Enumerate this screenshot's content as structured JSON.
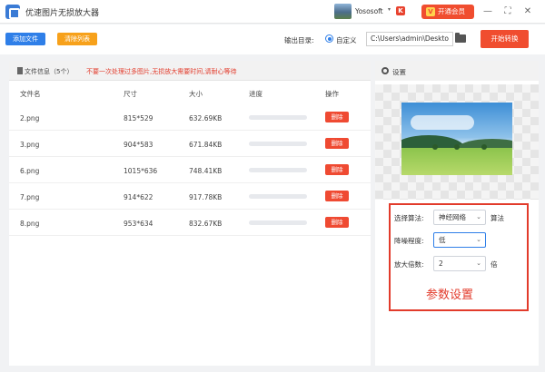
{
  "titlebar": {
    "title": "优速图片无损放大器",
    "user_name": "Yososoft",
    "user_badge": "K",
    "vip_label": "开通会员",
    "vip_icon": "V"
  },
  "toolbar": {
    "add_label": "添加文件",
    "clear_label": "清除列表",
    "output_label": "输出目录:",
    "radio_label": "自定义",
    "output_path": "C:\\Users\\admin\\Deskto",
    "start_label": "开始转换"
  },
  "file_panel": {
    "info_label": "文件信息（5个）",
    "warning": "不要一次处理过多图片,无损放大需要时间,请耐心等待",
    "columns": {
      "name": "文件名",
      "size": "尺寸",
      "filesize": "大小",
      "progress": "进度",
      "action": "操作"
    },
    "delete_label": "删除",
    "rows": [
      {
        "name": "2.png",
        "dims": "815*529",
        "filesize": "632.69KB",
        "progress": 0
      },
      {
        "name": "3.png",
        "dims": "904*583",
        "filesize": "671.84KB",
        "progress": 0
      },
      {
        "name": "6.png",
        "dims": "1015*636",
        "filesize": "748.41KB",
        "progress": 0
      },
      {
        "name": "7.png",
        "dims": "914*622",
        "filesize": "917.78KB",
        "progress": 0
      },
      {
        "name": "8.png",
        "dims": "953*634",
        "filesize": "832.67KB",
        "progress": 0
      }
    ]
  },
  "settings": {
    "label": "设置",
    "algorithm_label": "选择算法:",
    "algorithm_value": "神经网络",
    "algorithm_suffix": "算法",
    "noise_label": "降噪程度:",
    "noise_value": "低",
    "scale_label": "放大倍数:",
    "scale_value": "2",
    "scale_suffix": "倍",
    "section_title": "参数设置"
  },
  "colors": {
    "accent_blue": "#2f7fe8",
    "accent_red": "#f04d2f",
    "accent_orange": "#f7a11b"
  }
}
